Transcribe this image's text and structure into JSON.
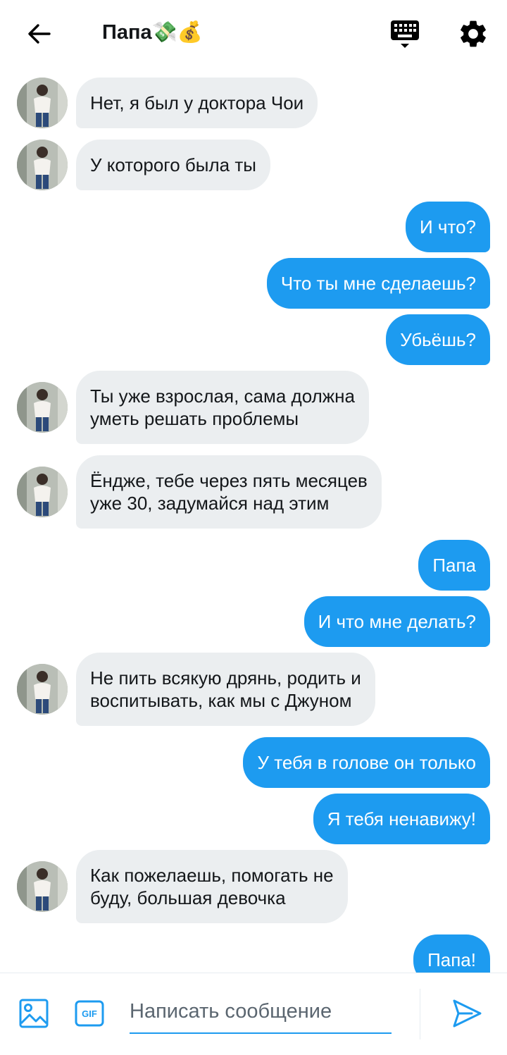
{
  "header": {
    "title": "Папа",
    "emoji": "💸💰"
  },
  "messages": [
    {
      "dir": "in",
      "text": "Нет, я был у доктора Чои"
    },
    {
      "dir": "in",
      "text": "У которого была ты"
    },
    {
      "dir": "out",
      "text": "И что?"
    },
    {
      "dir": "out",
      "text": "Что ты мне сделаешь?"
    },
    {
      "dir": "out",
      "text": "Убьёшь?"
    },
    {
      "dir": "in",
      "text": "Ты уже взрослая, сама должна\nуметь решать проблемы"
    },
    {
      "dir": "in",
      "text": "Ёндже, тебе через пять месяцев\nуже 30, задумайся над этим"
    },
    {
      "dir": "out",
      "text": "Папа"
    },
    {
      "dir": "out",
      "text": "И что мне делать?"
    },
    {
      "dir": "in",
      "text": "Не пить всякую дрянь, родить и\nвоспитывать, как мы с Джуном"
    },
    {
      "dir": "out",
      "text": "У тебя в голове он только"
    },
    {
      "dir": "out",
      "text": "Я тебя ненавижу!"
    },
    {
      "dir": "in",
      "text": "Как пожелаешь, помогать не\nбуду, большая девочка"
    },
    {
      "dir": "out",
      "text": "Папа!"
    }
  ],
  "composer": {
    "placeholder": "Написать сообщение",
    "gif_label": "GIF"
  },
  "colors": {
    "accent": "#1d9bf0",
    "incoming_bubble": "#ebeef0"
  },
  "icons": {
    "back": "arrow-left-icon",
    "keyboard": "keyboard-icon",
    "settings": "gear-icon",
    "image": "image-icon",
    "gif": "gif-icon",
    "send": "send-icon"
  }
}
